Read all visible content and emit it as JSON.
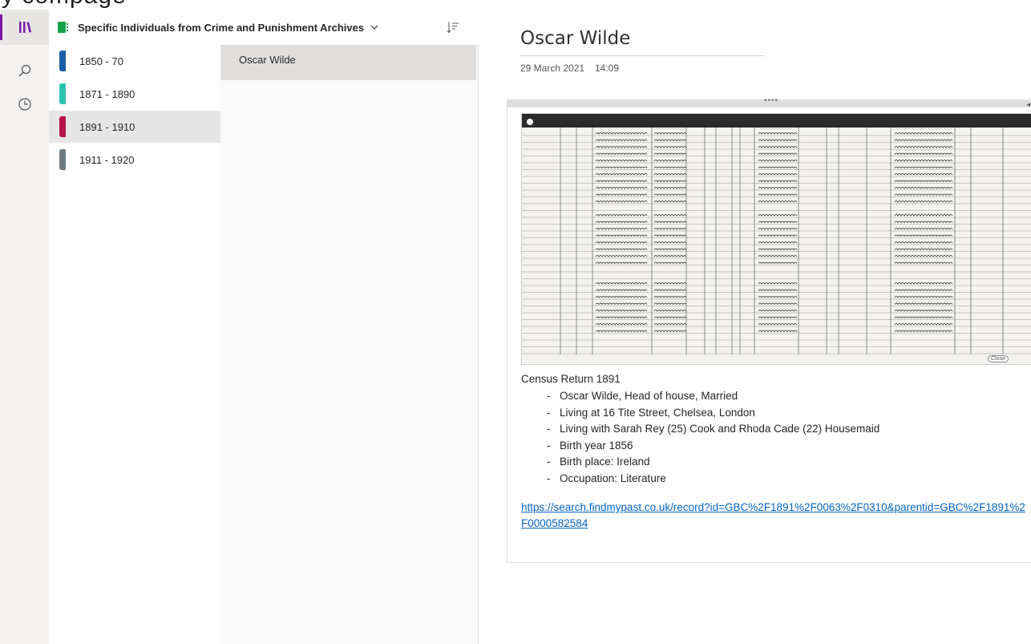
{
  "window": {
    "partial_title": "y compage"
  },
  "rail": {
    "items": [
      {
        "icon": "notebooks-icon",
        "active": true
      },
      {
        "icon": "search-icon",
        "active": false
      },
      {
        "icon": "recent-icon",
        "active": false
      }
    ]
  },
  "notebook": {
    "title": "Specific Individuals from Crime and Punishment Archives",
    "color": "#16a34a"
  },
  "sections": [
    {
      "label": "1850 - 70",
      "color": "#1c5fa8",
      "selected": false
    },
    {
      "label": "1871 - 1890",
      "color": "#2bc4b3",
      "selected": false
    },
    {
      "label": "1891 - 1910",
      "color": "#b5124a",
      "selected": true
    },
    {
      "label": "1911 - 1920",
      "color": "#6f7b80",
      "selected": false
    }
  ],
  "pages": [
    {
      "label": "Oscar Wilde",
      "selected": true
    }
  ],
  "page": {
    "title": "Oscar Wilde",
    "date": "29 March 2021",
    "time": "14:09",
    "image_alt": "Scanned 1891 census return page",
    "image_caption": "Close",
    "heading": "Census Return 1891",
    "bullets": [
      "Oscar Wilde, Head of house, Married",
      "Living at 16 Tite Street, Chelsea, London",
      "Living with Sarah Rey (25) Cook and Rhoda Cade (22) Housemaid",
      "Birth year 1856",
      "Birth place: Ireland",
      "Occupation: Literature"
    ],
    "link": "https://search.findmypast.co.uk/record?id=GBC%2F1891%2F0063%2F0310&parentid=GBC%2F1891%2F0000582584"
  },
  "colors": {
    "accent": "#7719aa",
    "link": "#0563c1"
  }
}
